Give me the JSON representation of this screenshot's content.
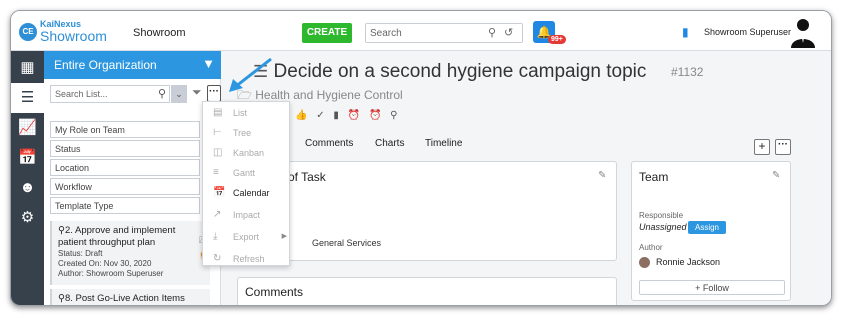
{
  "header": {
    "logo_small": "KaiNexus",
    "logo_big": "Showroom",
    "logo_badge": "CE",
    "workspace": "Showroom",
    "create_label": "CREATE",
    "search_placeholder": "Search",
    "notification_count": "99+",
    "user_name": "Showroom Superuser"
  },
  "sidebar": {
    "icons": [
      "grid-icon",
      "list-icon",
      "chart-icon",
      "calendar-icon",
      "people-icon",
      "gear-icon"
    ],
    "active_index": 1
  },
  "list_panel": {
    "org_title": "Entire Organization",
    "search_placeholder": "Search List...",
    "filters": [
      "My Role on Team",
      "Status",
      "Location",
      "Workflow",
      "Template Type"
    ],
    "cards": [
      {
        "title_line1": "2. Approve and implement",
        "title_line2": "patient throughput plan",
        "status": "Status: Draft",
        "created": "Created On: Nov 30, 2020",
        "author": "Author: Showroom Superuser"
      },
      {
        "title_line1": "8. Post Go-Live Action Items"
      }
    ]
  },
  "view_menu": {
    "items": [
      {
        "label": "List",
        "enabled": false,
        "icon": "list-view-icon"
      },
      {
        "label": "Tree",
        "enabled": false,
        "icon": "tree-view-icon"
      },
      {
        "label": "Kanban",
        "enabled": false,
        "icon": "kanban-view-icon"
      },
      {
        "label": "Gantt",
        "enabled": false,
        "icon": "gantt-view-icon"
      },
      {
        "label": "Calendar",
        "enabled": true,
        "icon": "calendar-view-icon"
      },
      {
        "label": "Impact",
        "enabled": false,
        "icon": "impact-icon"
      },
      {
        "label": "Export",
        "enabled": false,
        "icon": "export-icon"
      },
      {
        "label": "Refresh",
        "enabled": false,
        "icon": "refresh-icon"
      }
    ]
  },
  "item": {
    "title": "Decide on a second hygiene campaign topic",
    "number": "#1132",
    "folder": "Health and Hygiene Control",
    "tabs": [
      "Comments",
      "Charts",
      "Timeline"
    ],
    "type_section_title": "of Task",
    "type_value": "General Services",
    "comments_title": "Comments"
  },
  "team": {
    "title": "Team",
    "responsible_label": "Responsible",
    "responsible_value": "Unassigned",
    "assign_label": "Assign",
    "author_label": "Author",
    "author_name": "Ronnie Jackson",
    "follow_label": "Follow"
  },
  "colors": {
    "accent": "#2c97e0",
    "create_green": "#2eb82e",
    "nav_dark": "#37414c",
    "badge_red": "#e53935"
  }
}
